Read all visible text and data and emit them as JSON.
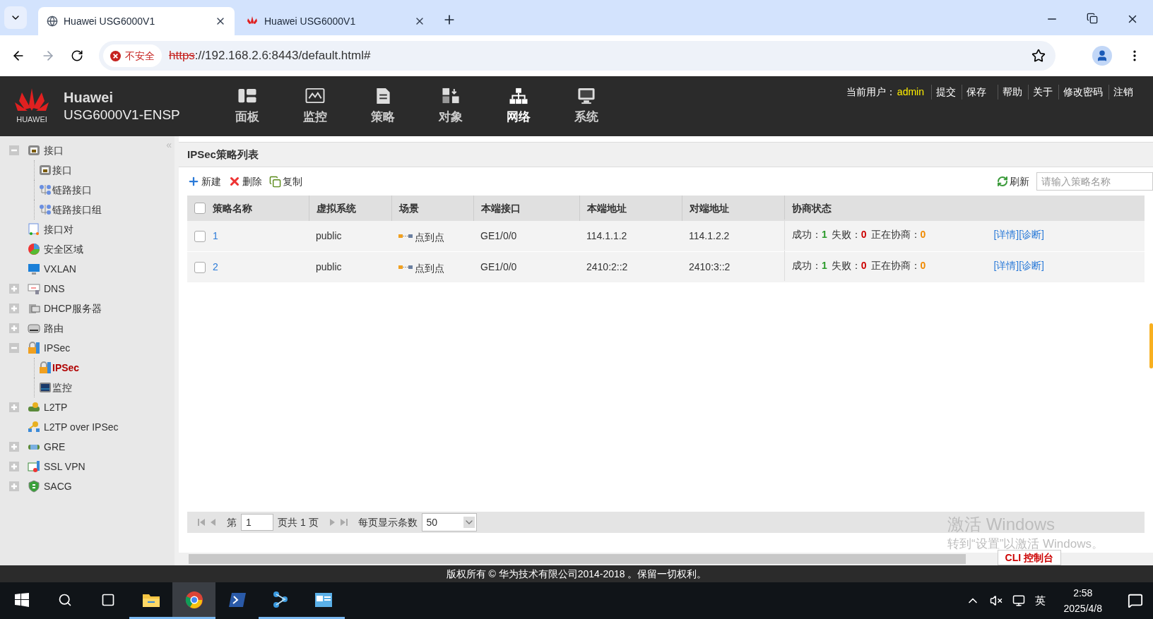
{
  "browser": {
    "tabs": [
      {
        "title": "Huawei USG6000V1",
        "selected": true
      },
      {
        "title": "Huawei USG6000V1",
        "selected": false
      }
    ],
    "security": "不安全",
    "url_scheme": "https",
    "url_rest": "://192.168.2.6:8443/default.html#"
  },
  "header": {
    "brand": "Huawei",
    "logo_text": "HUAWEI",
    "model": "USG6000V1-ENSP",
    "nav": [
      {
        "label": "面板",
        "selected": false
      },
      {
        "label": "监控",
        "selected": false
      },
      {
        "label": "策略",
        "selected": false
      },
      {
        "label": "对象",
        "selected": false
      },
      {
        "label": "网络",
        "selected": true
      },
      {
        "label": "系统",
        "selected": false
      }
    ],
    "user_label": "当前用户：",
    "user": "admin",
    "links": [
      "提交",
      "保存",
      "帮助",
      "关于",
      "修改密码",
      "注销"
    ]
  },
  "sidebar": {
    "collapse": "«",
    "items": [
      {
        "label": "接口",
        "expanded": true,
        "selected": false,
        "children": [
          {
            "label": "接口",
            "selected": false
          },
          {
            "label": "链路接口",
            "selected": false
          },
          {
            "label": "链路接口组",
            "selected": false
          }
        ]
      },
      {
        "label": "接口对",
        "selected": false
      },
      {
        "label": "安全区域",
        "selected": false
      },
      {
        "label": "VXLAN",
        "selected": false
      },
      {
        "label": "DNS",
        "expanded": false,
        "selected": false
      },
      {
        "label": "DHCP服务器",
        "expanded": false,
        "selected": false
      },
      {
        "label": "路由",
        "expanded": false,
        "selected": false
      },
      {
        "label": "IPSec",
        "expanded": true,
        "selected": false,
        "children": [
          {
            "label": "IPSec",
            "selected": true
          },
          {
            "label": "监控",
            "selected": false
          }
        ]
      },
      {
        "label": "L2TP",
        "expanded": false,
        "selected": false
      },
      {
        "label": "L2TP over IPSec",
        "selected": false
      },
      {
        "label": "GRE",
        "expanded": false,
        "selected": false
      },
      {
        "label": "SSL VPN",
        "expanded": false,
        "selected": false
      },
      {
        "label": "SACG",
        "expanded": false,
        "selected": false
      }
    ]
  },
  "panel": {
    "title": "IPSec策略列表",
    "actions": [
      "新建",
      "删除",
      "复制"
    ],
    "refresh": "刷新",
    "search": {
      "placeholder": "请输入策略名称"
    },
    "table": {
      "select_all": false,
      "columns": [
        "策略名称",
        "虚拟系统",
        "场景",
        "本端接口",
        "本端地址",
        "对端地址",
        "协商状态"
      ],
      "rows": [
        {
          "checked": false,
          "name": "1",
          "vsys": "public",
          "scene": "点到点",
          "interface": "GE1/0/0",
          "local": "114.1.1.2",
          "peer": "114.1.2.2",
          "success_label": "成功：",
          "success": "1",
          "fail_label": "失败：",
          "fail": "0",
          "pending_label": "正在协商：",
          "pending": "0",
          "links": [
            "[详情]",
            "[诊断]"
          ]
        },
        {
          "checked": false,
          "name": "2",
          "vsys": "public",
          "scene": "点到点",
          "interface": "GE1/0/0",
          "local": "2410:2::2",
          "peer": "2410:3::2",
          "success_label": "成功：",
          "success": "1",
          "fail_label": "失败：",
          "fail": "0",
          "pending_label": "正在协商：",
          "pending": "0",
          "links": [
            "[详情]",
            "[诊断]"
          ]
        }
      ]
    },
    "pager": {
      "page_prefix": "第",
      "page": "1",
      "page_suffix": "页共 1 页",
      "per_page_label": "每页显示条数",
      "per_page": "50"
    },
    "cli": "CLI 控制台"
  },
  "footer": "版权所有 © 华为技术有限公司2014-2018 。保留一切权利。",
  "activation": {
    "title": "激活 Windows",
    "subtitle": "转到“设置”以激活 Windows。"
  },
  "taskbar": {
    "apps": [
      {
        "active": false,
        "open": false
      },
      {
        "active": false,
        "open": false
      },
      {
        "active": false,
        "open": false
      },
      {
        "active": false,
        "open": true
      },
      {
        "active": true,
        "open": true
      },
      {
        "active": false,
        "open": false
      },
      {
        "active": false,
        "open": true
      },
      {
        "active": false,
        "open": true
      }
    ],
    "ime": "英",
    "time": "2:58",
    "date": "2025/4/8"
  }
}
